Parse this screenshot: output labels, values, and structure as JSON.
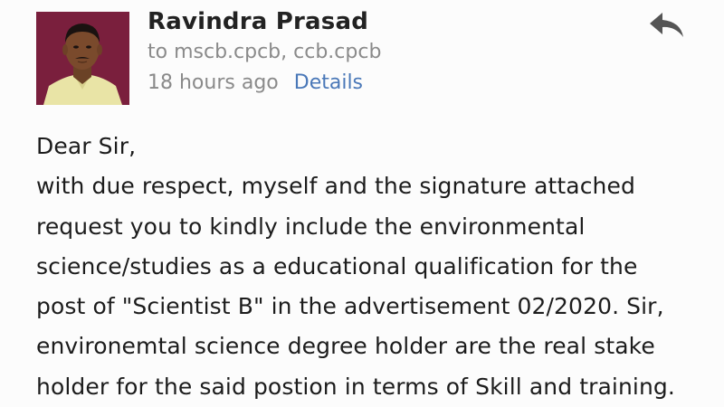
{
  "sender": {
    "name": "Ravindra Prasad",
    "recipients": "to mscb.cpcb, ccb.cpcb",
    "timestamp": "18 hours ago",
    "details_label": "Details",
    "avatar_icon": "profile-photo"
  },
  "actions": {
    "reply_icon": "reply-arrow-icon"
  },
  "body": {
    "lines": [
      "Dear Sir,",
      "with due respect, myself and the signature attached",
      "request you to kindly include the environmental",
      "science/studies as a educational qualification for the",
      "post of \"Scientist B\" in the advertisement 02/2020. Sir,",
      "environemtal science degree holder are the real stake",
      "holder for the said postion in terms of Skill and training."
    ]
  },
  "colors": {
    "background": "#fcfcfc",
    "link": "#4a78b8",
    "muted_text": "#8a8a8a",
    "avatar_bg": "#7a1f3d"
  }
}
